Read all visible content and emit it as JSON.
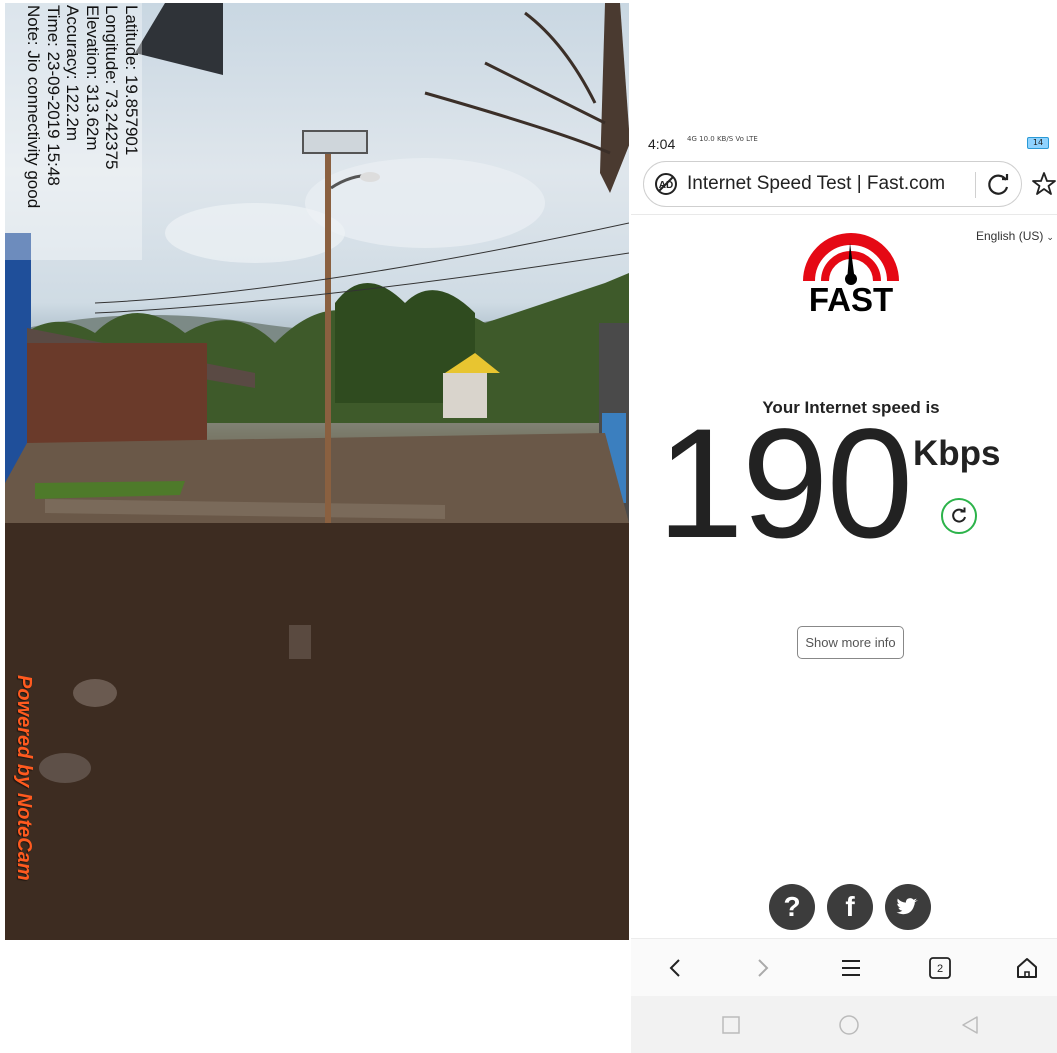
{
  "photo": {
    "gps_lines": [
      "Latitude: 19.857901",
      "Longitude: 73.242375",
      "Elevation: 313.62m",
      "Accuracy: 122.2m",
      "Time: 23-09-2019 15:48",
      "Note: Jio connectivity good"
    ],
    "watermark": "Powered by NoteCam",
    "watermark_color": "#ff5a1f"
  },
  "phone": {
    "status": {
      "time": "4:04",
      "network_speed": "10.0",
      "network_unit": "KB/S",
      "network_type": "Vo LTE",
      "signal": "4G",
      "battery": "14"
    },
    "browser": {
      "page_title": "Internet Speed Test | Fast.com"
    },
    "page": {
      "language": "English (US)",
      "logo_text": "FAST",
      "speed_label": "Your Internet speed is",
      "speed_value": "190",
      "speed_unit": "Kbps",
      "more_info_label": "Show more info",
      "accent_color": "#e50914",
      "retest_color": "#2cb34a"
    },
    "tabs_count": "2"
  }
}
